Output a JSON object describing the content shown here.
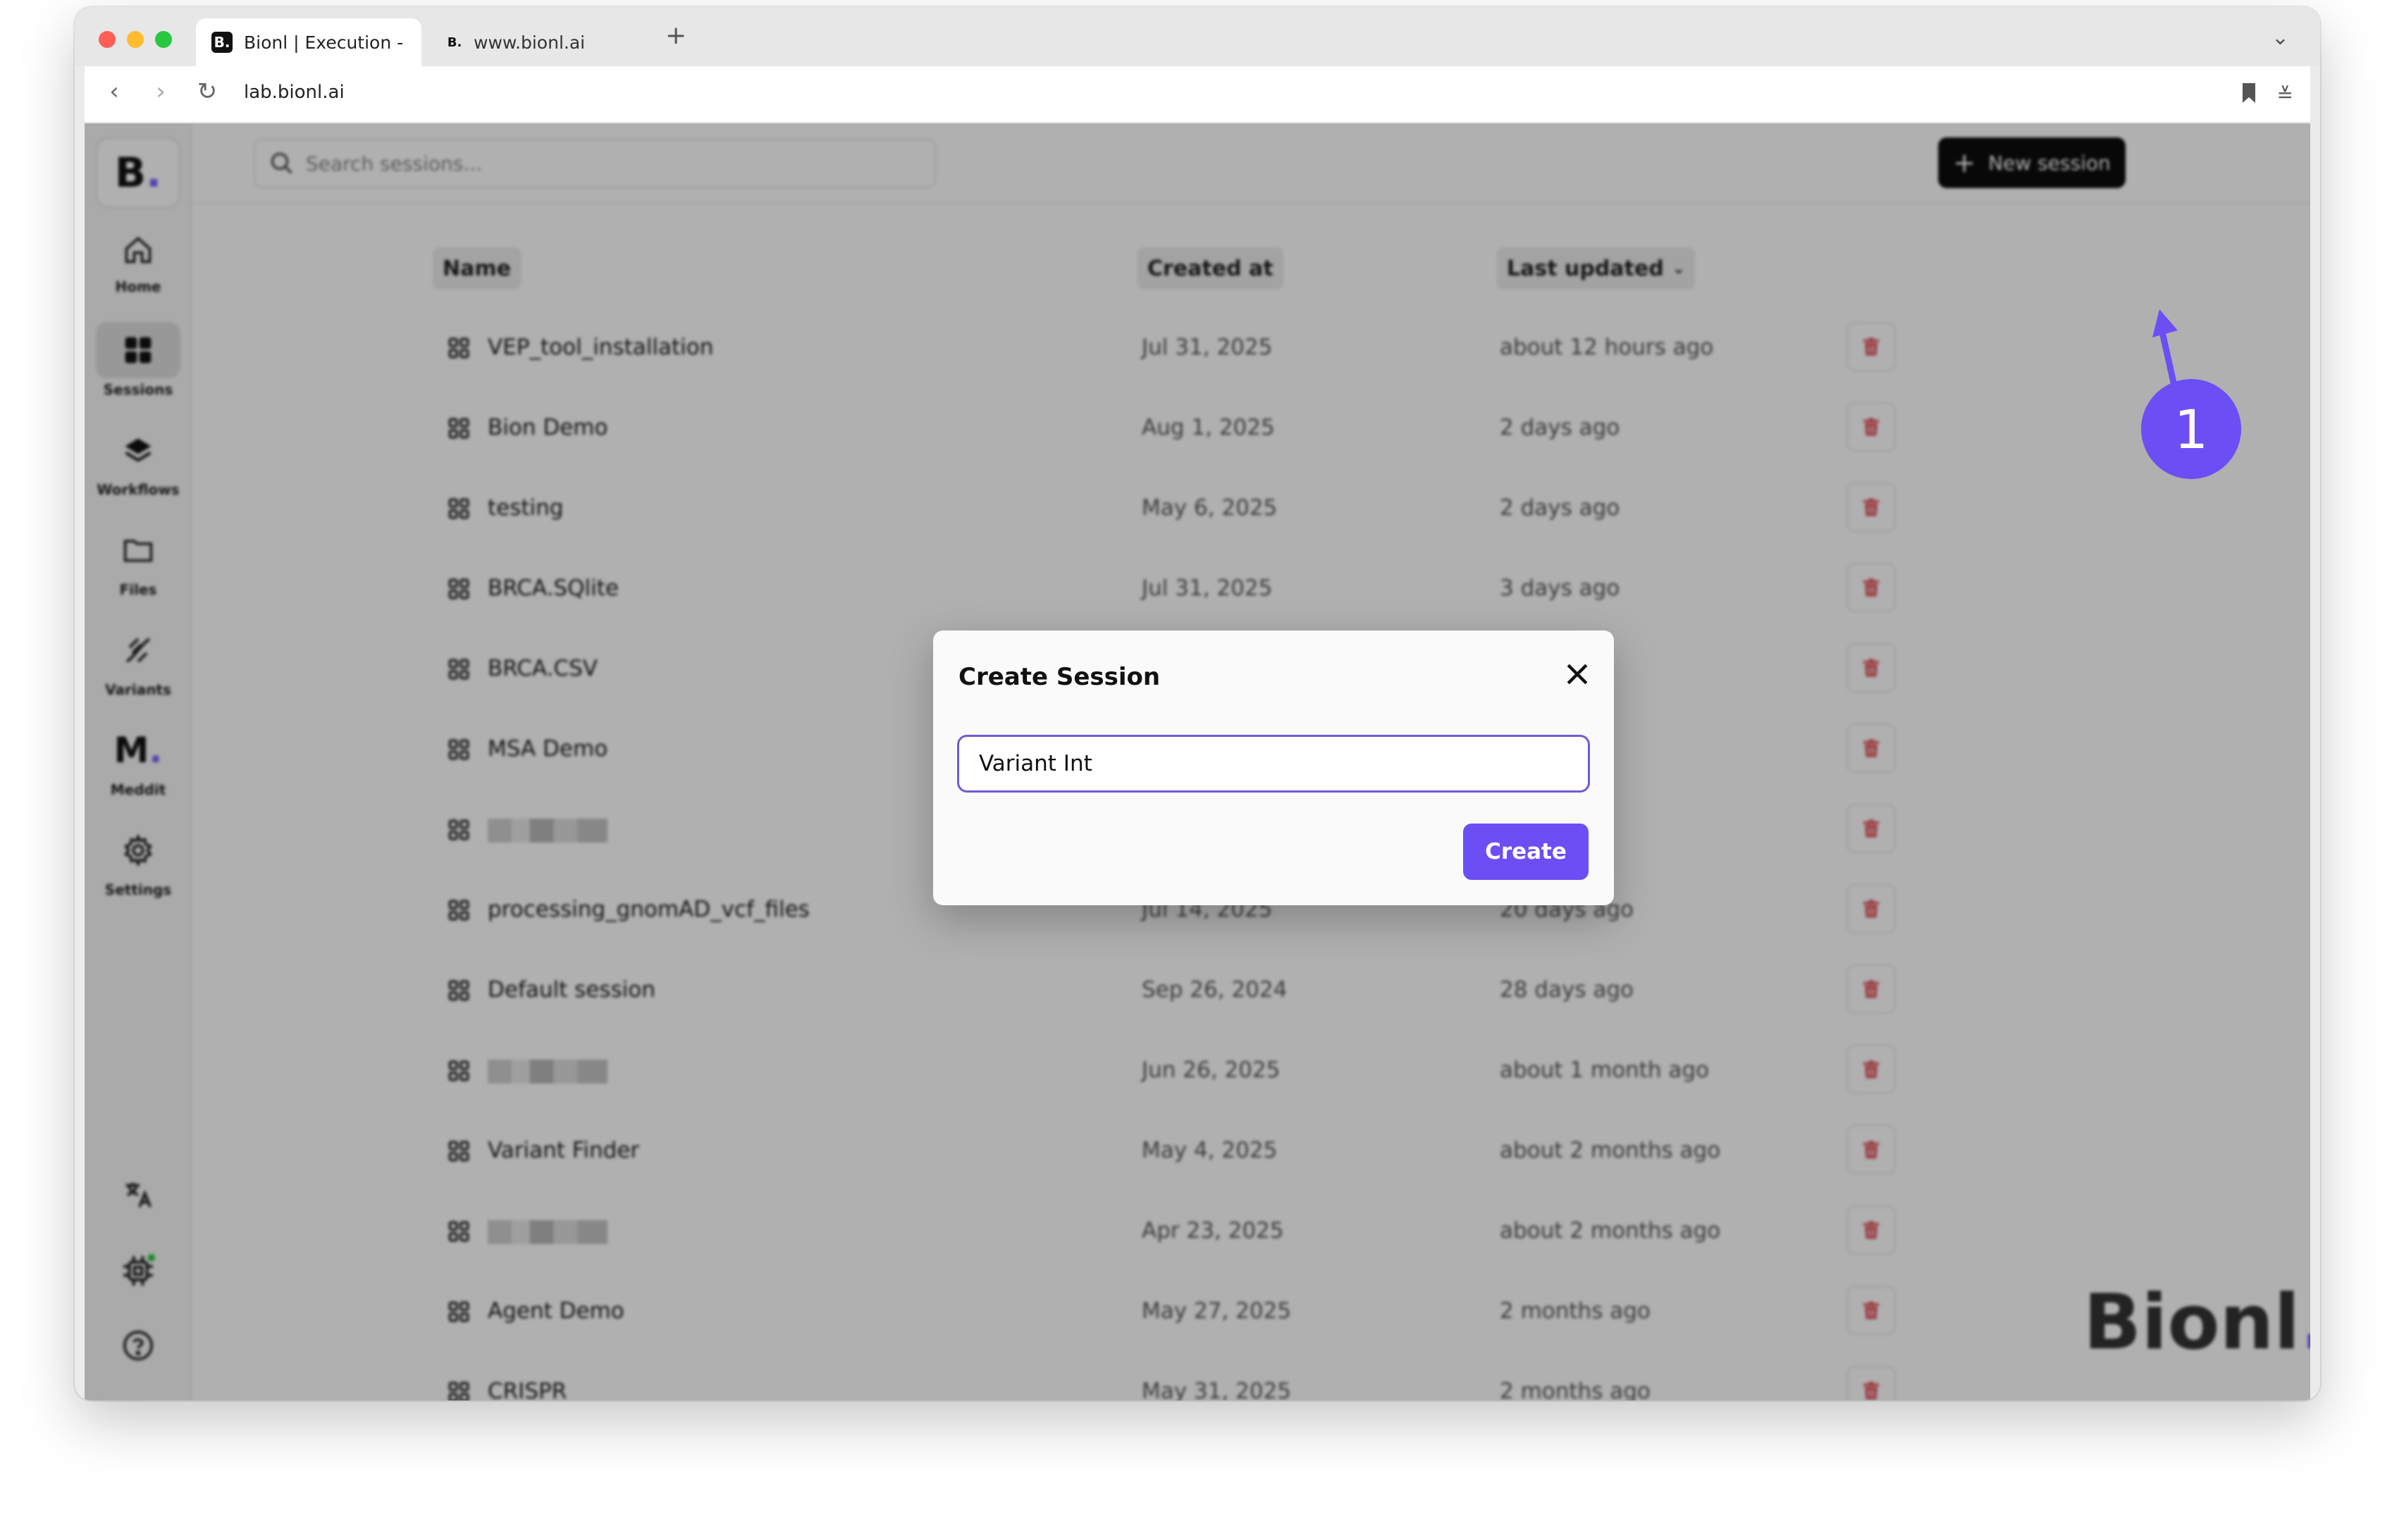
{
  "browser": {
    "tabs": [
      {
        "label": "Bionl | Execution - ",
        "favicon": "B.",
        "active": true
      },
      {
        "label": "www.bionl.ai",
        "favicon": "B.",
        "active": false
      }
    ],
    "url": "lab.bionl.ai"
  },
  "sidebar": {
    "logo": "B",
    "items": [
      {
        "label": "Home",
        "icon": "home-icon"
      },
      {
        "label": "Sessions",
        "icon": "grid-icon",
        "active": true
      },
      {
        "label": "Workflows",
        "icon": "layers-icon"
      },
      {
        "label": "Files",
        "icon": "folder-icon"
      },
      {
        "label": "Variants",
        "icon": "dna-icon"
      },
      {
        "label": "Meddit",
        "icon": "m-logo-icon"
      },
      {
        "label": "Settings",
        "icon": "gear-icon"
      }
    ],
    "logo_M": "M"
  },
  "toolbar": {
    "search_placeholder": "Search sessions...",
    "new_session_label": "New session"
  },
  "table": {
    "headers": {
      "name": "Name",
      "created": "Created at",
      "updated": "Last updated"
    },
    "rows": [
      {
        "name": "VEP_tool_installation",
        "created": "Jul 31, 2025",
        "updated": "about 12 hours ago"
      },
      {
        "name": "Bion Demo",
        "created": "Aug 1, 2025",
        "updated": "2 days ago"
      },
      {
        "name": "testing",
        "created": "May 6, 2025",
        "updated": "2 days ago"
      },
      {
        "name": "BRCA.SQlite",
        "created": "Jul 31, 2025",
        "updated": "3 days ago"
      },
      {
        "name": "BRCA.CSV",
        "created": "",
        "updated": ""
      },
      {
        "name": "MSA Demo",
        "created": "",
        "updated": ""
      },
      {
        "name": "",
        "created": "",
        "updated": "",
        "redacted": true
      },
      {
        "name": "processing_gnomAD_vcf_files",
        "created": "Jul 14, 2025",
        "updated": "20 days ago"
      },
      {
        "name": "Default session",
        "created": "Sep 26, 2024",
        "updated": "28 days ago"
      },
      {
        "name": "",
        "created": "Jun 26, 2025",
        "updated": "about 1 month ago",
        "redacted": true
      },
      {
        "name": "Variant Finder",
        "created": "May 4, 2025",
        "updated": "about 2 months ago"
      },
      {
        "name": "",
        "created": "Apr 23, 2025",
        "updated": "about 2 months ago",
        "redacted": true
      },
      {
        "name": "Agent Demo",
        "created": "May 27, 2025",
        "updated": "2 months ago"
      },
      {
        "name": "CRISPR",
        "created": "May 31, 2025",
        "updated": "2 months ago"
      }
    ]
  },
  "watermark": {
    "text": "Bionl",
    "dot": "."
  },
  "modal": {
    "title": "Create Session",
    "input_value": "Variant Int",
    "create_label": "Create"
  },
  "annotation": {
    "step": "1"
  },
  "colors": {
    "accent": "#6c4ef5",
    "danger": "#e0525c",
    "dark": "#0d0d0d"
  }
}
